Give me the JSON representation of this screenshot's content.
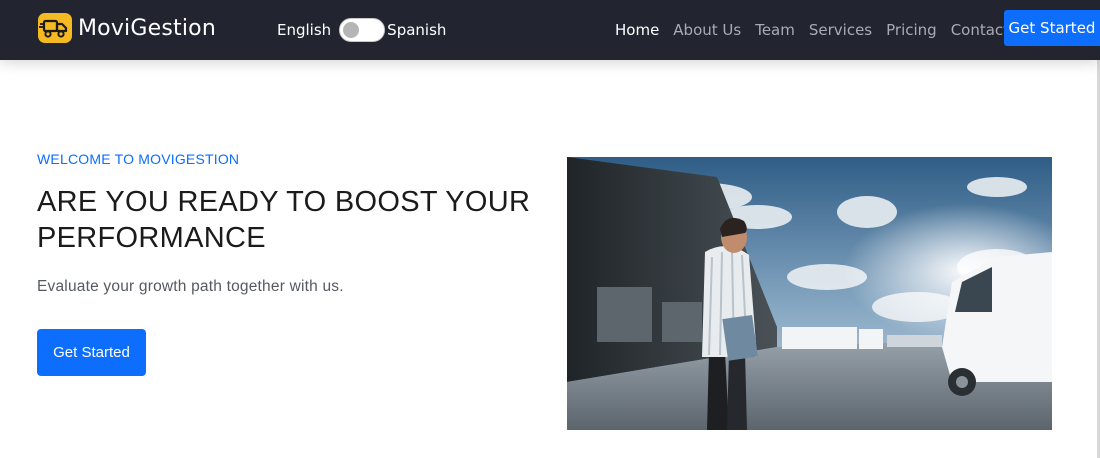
{
  "navbar": {
    "brand_name": "MoviGestion",
    "brand_icon": "truck-icon",
    "language": {
      "left_label": "English",
      "right_label": "Spanish"
    },
    "links": [
      {
        "label": "Home",
        "active": true
      },
      {
        "label": "About Us",
        "active": false
      },
      {
        "label": "Team",
        "active": false
      },
      {
        "label": "Services",
        "active": false
      },
      {
        "label": "Pricing",
        "active": false
      },
      {
        "label": "Contact Us",
        "active": false
      }
    ],
    "cta_label": "Get Started"
  },
  "hero": {
    "eyebrow": "WELCOME TO MOVIGESTION",
    "headline": "ARE YOU READY TO BOOST YOUR PERFORMANCE",
    "subtext": "Evaluate your growth path together with us.",
    "cta_label": "Get Started",
    "image_subject": "businessman-warehouse-photo"
  },
  "colors": {
    "navbar_bg": "#222530",
    "accent": "#0d6efd",
    "logo_yellow": "#f5b921"
  }
}
